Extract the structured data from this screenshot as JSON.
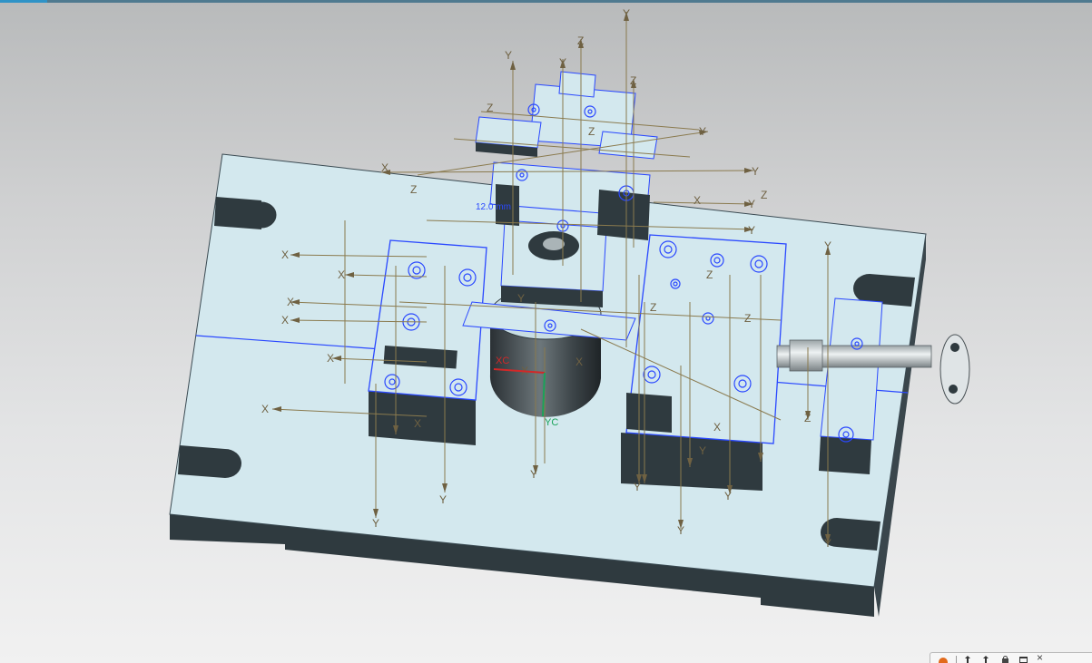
{
  "window": {
    "accent_color": "#2f93c7"
  },
  "viewport": {
    "background_top": "#b8babb",
    "background_bottom": "#f1f1f1",
    "model_face_color": "#cfe6ec",
    "model_edge_color": "#2f3a3f",
    "selection_color": "#2a48ff",
    "csys_color": "#8a7a4e",
    "wcs_x_label": "XC",
    "wcs_y_label": "YC",
    "csys_labels": {
      "x": "X",
      "y": "Y",
      "z": "Z"
    },
    "dimension_label": "12.0 mm"
  },
  "mini_toolbar": {
    "icons": [
      "snap-icon",
      "arrow-icon",
      "select-icon",
      "lock-icon",
      "window-icon",
      "close-icon"
    ]
  }
}
